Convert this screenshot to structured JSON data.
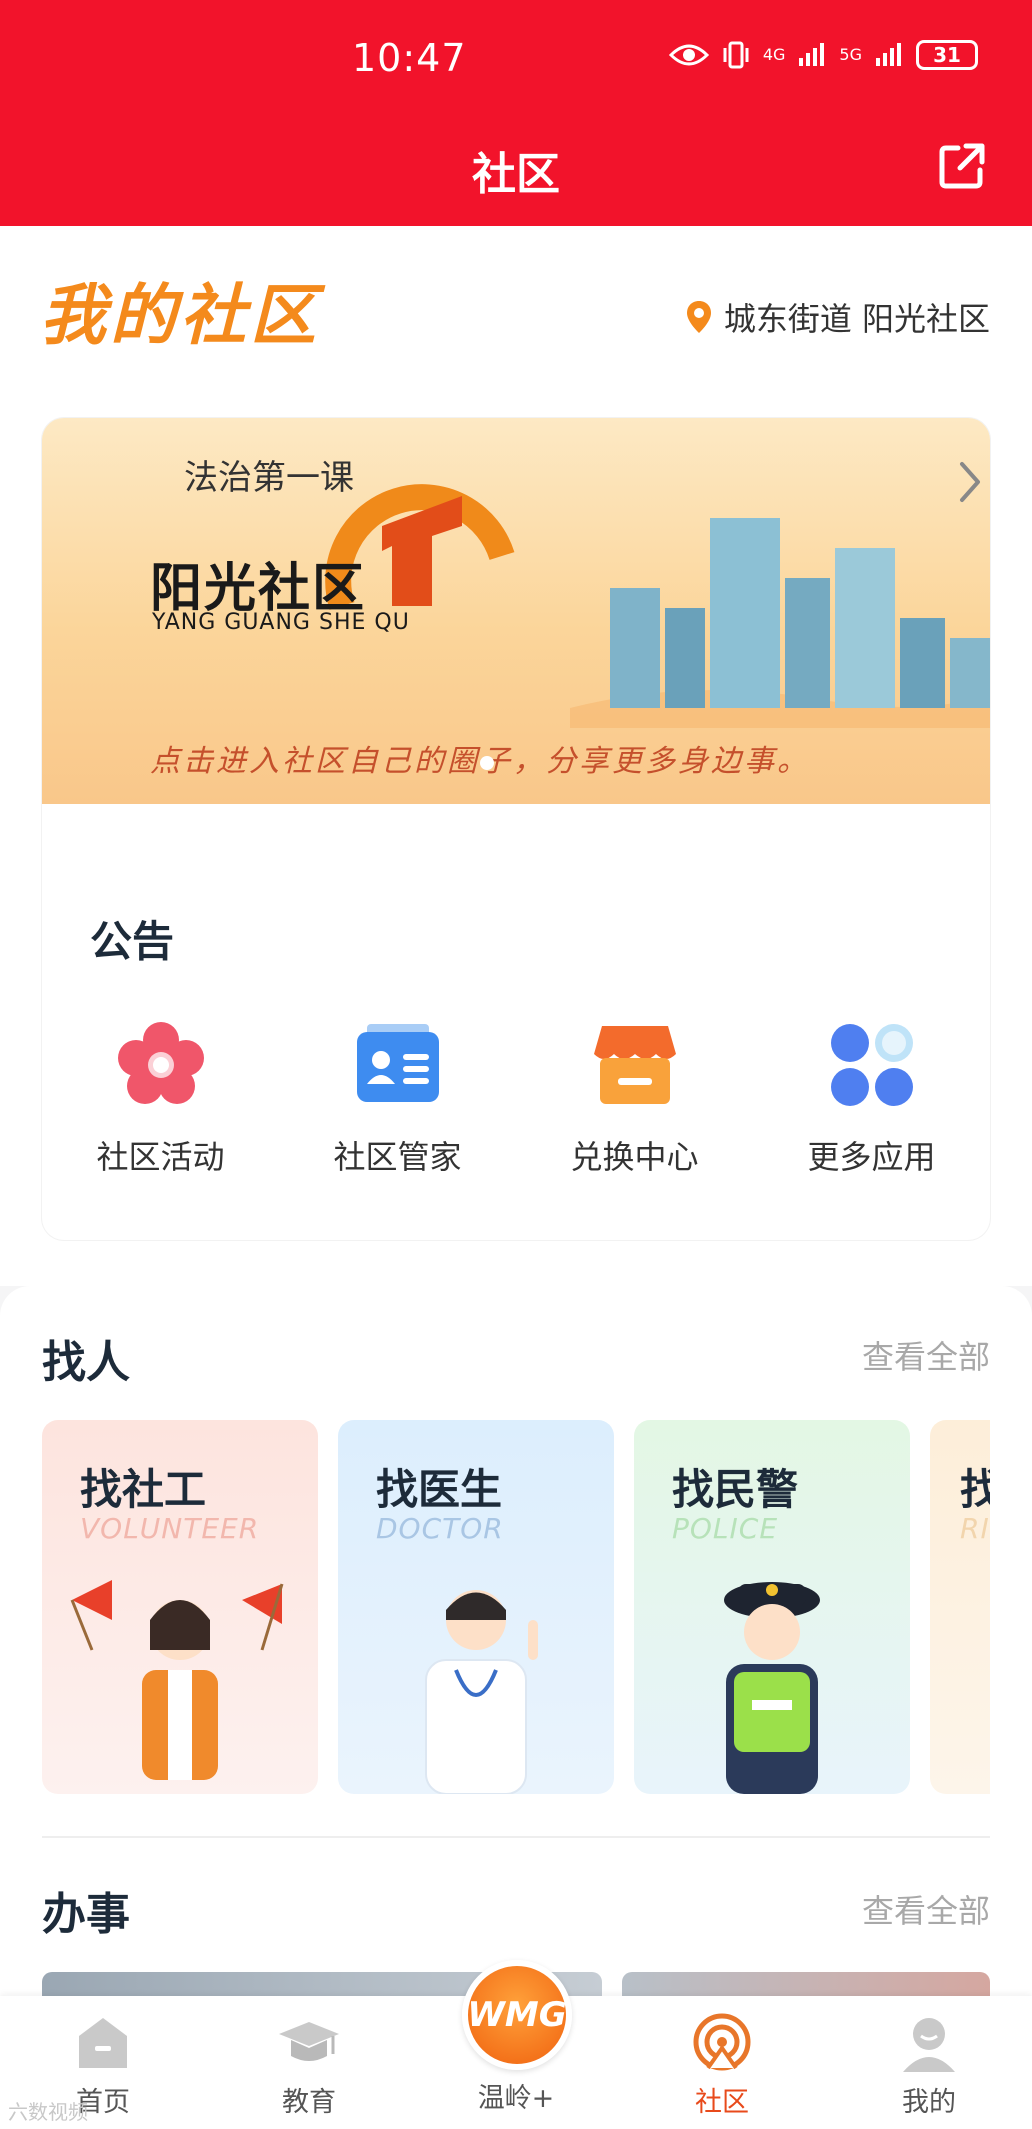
{
  "status_bar": {
    "time": "10:47",
    "net1": "4G",
    "net2": "5G",
    "battery": "31"
  },
  "header": {
    "title": "社区"
  },
  "brand": {
    "title": "我的社区",
    "location": "城东街道 阳光社区"
  },
  "banner": {
    "name": "阳光社区",
    "sub": "YANG GUANG SHE QU",
    "slogan": "点击进入社区自己的圈子，分享更多身边事。"
  },
  "notice": {
    "label": "公告",
    "text": "法治第一课"
  },
  "apps": [
    {
      "label": "社区活动",
      "icon": "flower-icon"
    },
    {
      "label": "社区管家",
      "icon": "id-card-icon"
    },
    {
      "label": "兑换中心",
      "icon": "shop-icon"
    },
    {
      "label": "更多应用",
      "icon": "grid-icon"
    }
  ],
  "find_people": {
    "title": "找人",
    "more": "查看全部",
    "cards": [
      {
        "title": "找社工",
        "en": "VOLUNTEER"
      },
      {
        "title": "找医生",
        "en": "DOCTOR"
      },
      {
        "title": "找民警",
        "en": "POLICE"
      },
      {
        "title": "找",
        "en": "RI"
      }
    ]
  },
  "affairs": {
    "title": "办事",
    "more": "查看全部"
  },
  "nav": {
    "items": [
      {
        "label": "首页"
      },
      {
        "label": "教育"
      },
      {
        "label": "温岭+"
      },
      {
        "label": "社区"
      },
      {
        "label": "我的"
      }
    ],
    "center_logo": "WMG"
  },
  "watermark": "六数视频",
  "colors": {
    "brand_red": "#f2132b",
    "accent_orange": "#f48a1c",
    "active_nav": "#e84a1b"
  }
}
